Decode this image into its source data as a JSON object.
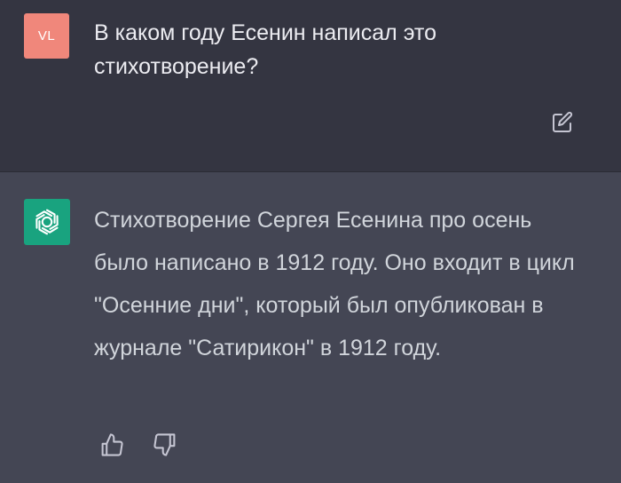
{
  "user_message": {
    "avatar_initials": "VL",
    "avatar_color": "#f0877b",
    "text": "В каком году Есенин написал это стихотворение?",
    "edit_icon": "edit-icon"
  },
  "assistant_message": {
    "avatar_icon": "openai-logo-icon",
    "avatar_color": "#19a37f",
    "text": "Стихотворение Сергея Есенина про осень было написано в 1912 году. Оно входит в цикл \"Осенние дни\", который был опубликован в журнале \"Сатирикон\" в 1912 году.",
    "feedback_icons": [
      "thumbs-up-icon",
      "thumbs-down-icon"
    ]
  },
  "colors": {
    "user_background": "#343541",
    "assistant_background": "#444654",
    "icon_color": "#c5c5d2"
  }
}
